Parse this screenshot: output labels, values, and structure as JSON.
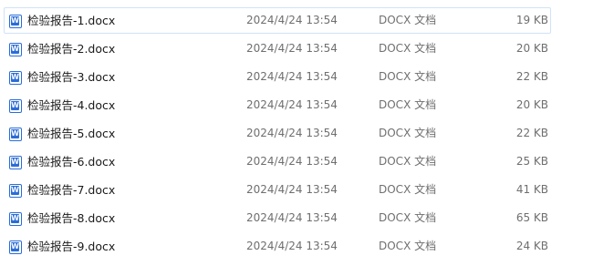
{
  "files": [
    {
      "name": "检验报告-1.docx",
      "date": "2024/4/24 13:54",
      "type": "DOCX 文档",
      "size": "19 KB",
      "icon": "word-document-icon",
      "icon_glyph": "W"
    },
    {
      "name": "检验报告-2.docx",
      "date": "2024/4/24 13:54",
      "type": "DOCX 文档",
      "size": "20 KB",
      "icon": "word-document-icon",
      "icon_glyph": "W"
    },
    {
      "name": "检验报告-3.docx",
      "date": "2024/4/24 13:54",
      "type": "DOCX 文档",
      "size": "22 KB",
      "icon": "word-document-icon",
      "icon_glyph": "W"
    },
    {
      "name": "检验报告-4.docx",
      "date": "2024/4/24 13:54",
      "type": "DOCX 文档",
      "size": "20 KB",
      "icon": "word-document-icon",
      "icon_glyph": "W"
    },
    {
      "name": "检验报告-5.docx",
      "date": "2024/4/24 13:54",
      "type": "DOCX 文档",
      "size": "22 KB",
      "icon": "word-document-icon",
      "icon_glyph": "W"
    },
    {
      "name": "检验报告-6.docx",
      "date": "2024/4/24 13:54",
      "type": "DOCX 文档",
      "size": "25 KB",
      "icon": "word-document-icon",
      "icon_glyph": "W"
    },
    {
      "name": "检验报告-7.docx",
      "date": "2024/4/24 13:54",
      "type": "DOCX 文档",
      "size": "41 KB",
      "icon": "word-document-icon",
      "icon_glyph": "W"
    },
    {
      "name": "检验报告-8.docx",
      "date": "2024/4/24 13:54",
      "type": "DOCX 文档",
      "size": "65 KB",
      "icon": "word-document-icon",
      "icon_glyph": "W"
    },
    {
      "name": "检验报告-9.docx",
      "date": "2024/4/24 13:54",
      "type": "DOCX 文档",
      "size": "24 KB",
      "icon": "word-document-icon",
      "icon_glyph": "W"
    }
  ],
  "colors": {
    "icon_blue": "#2a6dd8",
    "selection_border": "#cfe3f7",
    "secondary_text": "#6f6f6f"
  }
}
